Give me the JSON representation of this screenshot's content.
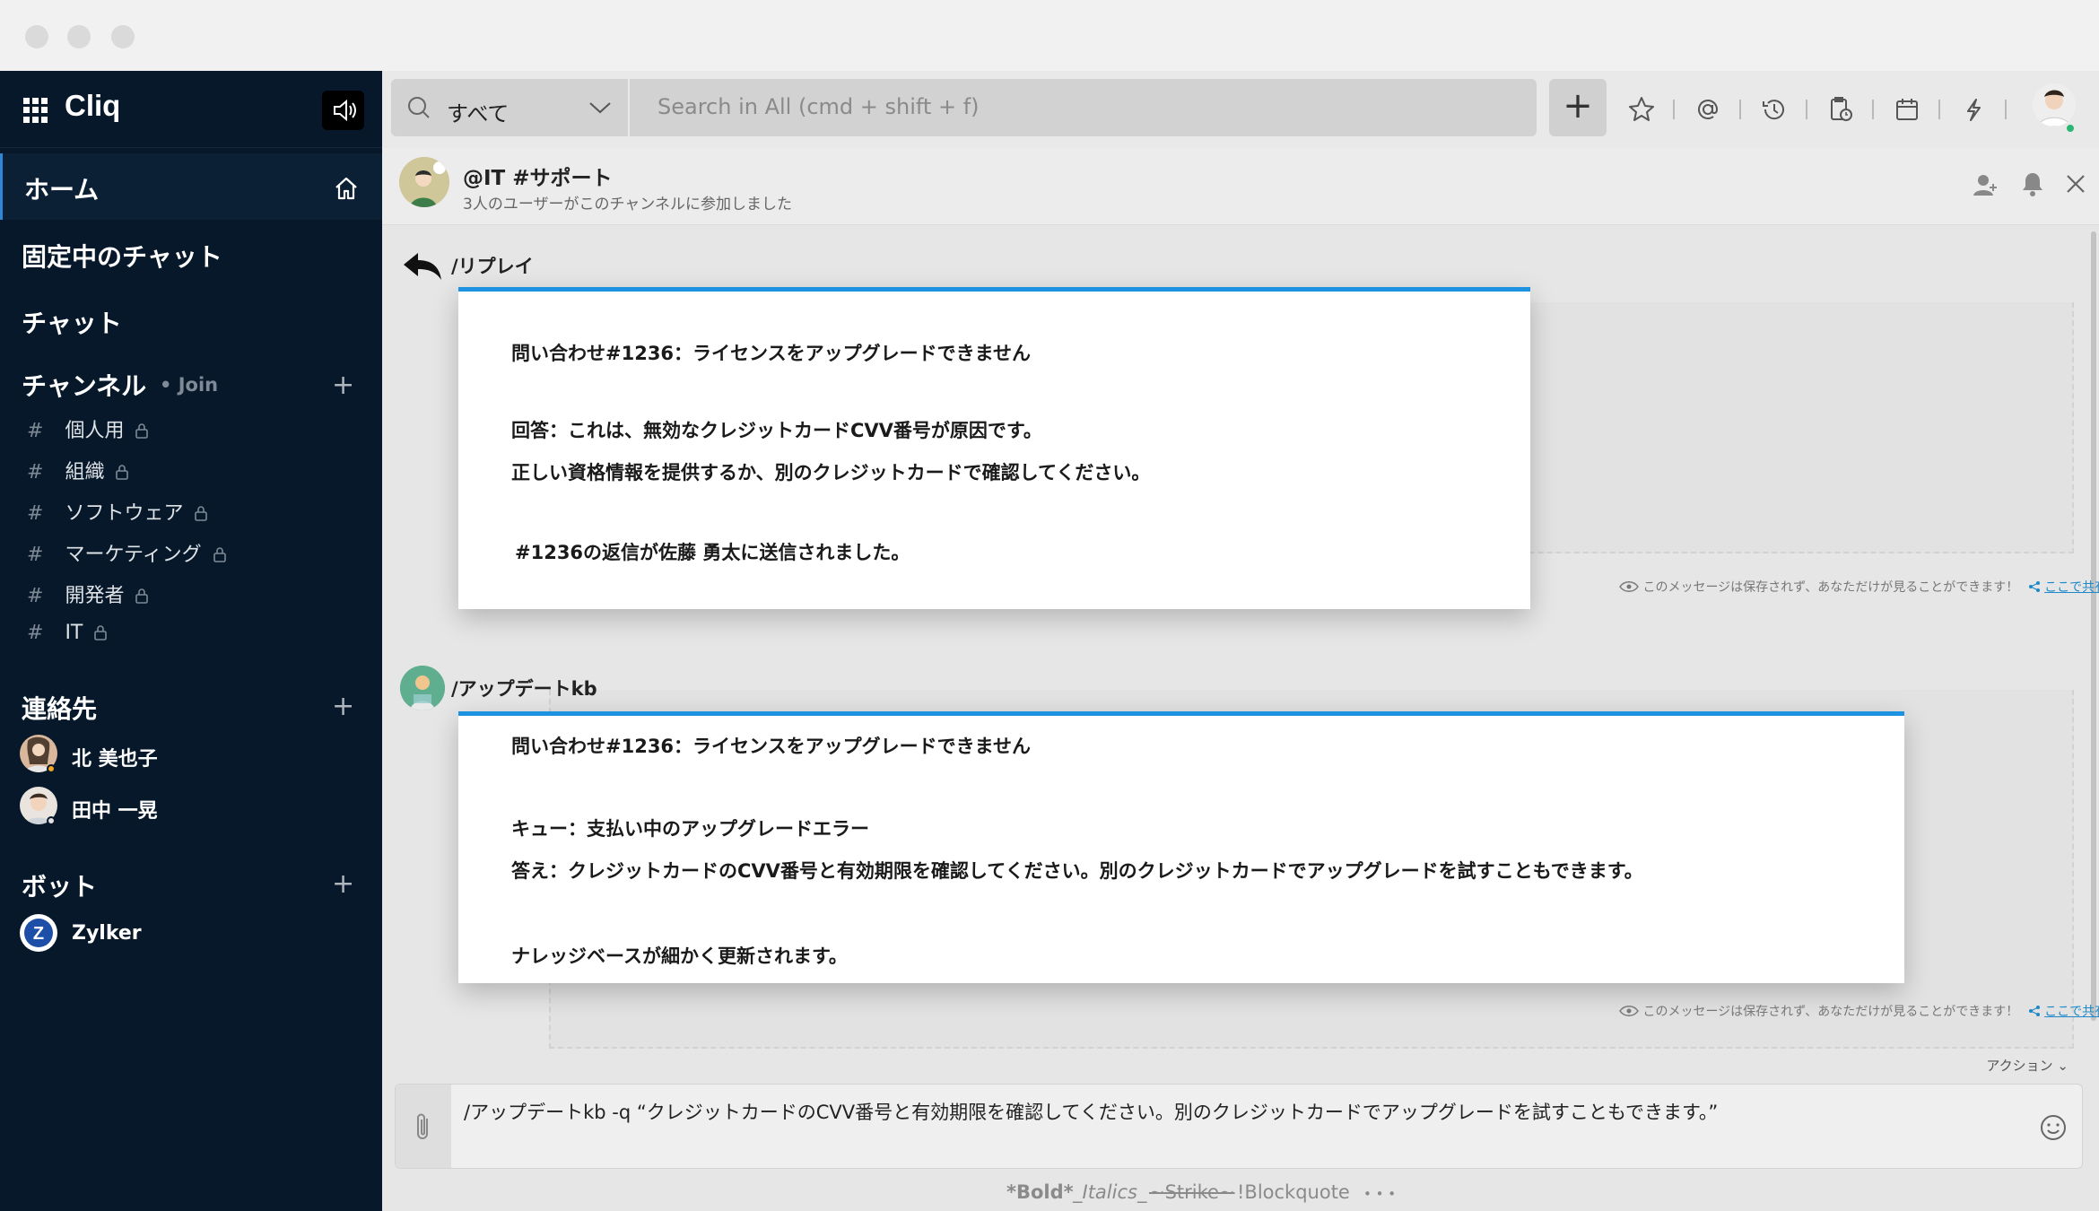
{
  "app": {
    "name": "Cliq"
  },
  "sidebar": {
    "home": "ホーム",
    "pinned": "固定中のチャット",
    "chats": "チャット",
    "channels_title": "チャンネル",
    "channels_join": "• Join",
    "channels": [
      {
        "label": "個人用"
      },
      {
        "label": "組織"
      },
      {
        "label": "ソフトウェア"
      },
      {
        "label": "マーケティング"
      },
      {
        "label": "開発者"
      },
      {
        "label": "IT"
      }
    ],
    "contacts_title": "連絡先",
    "contacts": [
      {
        "name": "北 美也子"
      },
      {
        "name": "田中 一晃"
      }
    ],
    "bots_title": "ボット",
    "bots": [
      {
        "name": "Zylker"
      }
    ]
  },
  "topbar": {
    "scope": "すべて",
    "search_placeholder": "Search in All  (cmd + shift + f)",
    "add": "+",
    "icons": [
      "star-icon",
      "mention-icon",
      "history-icon",
      "reminder-icon",
      "calendar-icon",
      "integrations-icon"
    ]
  },
  "channel": {
    "name": "@IT #サポート",
    "subtitle": "3人のユーザーがこのチャンネルに参加しました"
  },
  "messages": [
    {
      "sender": "/リプレイ",
      "lines": [
        "問い合わせ#1236：ライセンスをアップグレードできません",
        "回答：これは、無効なクレジットカードCVV番号が原因です。",
        "正しい資格情報を提供するか、別のクレジットカードで確認してください。",
        "#1236の返信が佐藤 勇太に送信されました。"
      ],
      "ephemeral": "このメッセージは保存されず、あなただけが見ることができます！",
      "share": "ここで共有"
    },
    {
      "sender": "/アップデートkb",
      "lines": [
        "問い合わせ#1236：ライセンスをアップグレードできません",
        "キュー：支払い中のアップグレードエラー",
        "答え：クレジットカードのCVV番号と有効期限を確認してください。別のクレジットカードでアップグレードを試すこともできます。",
        "ナレッジベースが細かく更新されます。"
      ],
      "ephemeral": "このメッセージは保存されず、あなただけが見ることができます！",
      "share": "ここで共有"
    }
  ],
  "composer": {
    "actions": "アクション ⌄",
    "text": "/アップデートkb -q “クレジットカードのCVV番号と有効期限を確認してください。別のクレジットカードでアップグレードを試すこともできます。”",
    "formats": {
      "bold": "*Bold*",
      "italics": "_Italics_",
      "strike": "~Strike~",
      "blockquote": "!Blockquote",
      "more": "• • •"
    }
  }
}
